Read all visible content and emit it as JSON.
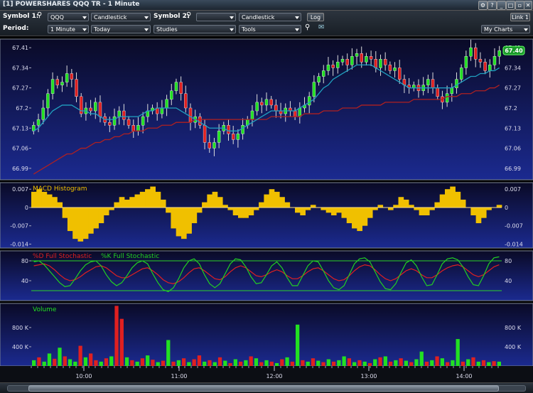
{
  "window": {
    "title": "[1] POWERSHARES QQQ TR - 1 Minute",
    "link_label": "Link 1"
  },
  "toolbar": {
    "symbol1_label": "Symbol 1:",
    "symbol1_value": "QQQ",
    "chart_type1": "Candlestick",
    "symbol2_label": "Symbol 2:",
    "symbol2_value": "",
    "chart_type2": "Candlestick",
    "log_label": "Log",
    "period_label": "Period:",
    "period_value": "1 Minute",
    "range_value": "Today",
    "studies_label": "Studies",
    "tools_label": "Tools",
    "mycharts_label": "My Charts"
  },
  "colors": {
    "up": "#22e022",
    "down": "#e02020",
    "ma_short": "#20a0c0",
    "ma_long": "#b02020",
    "macd": "#f0c000",
    "panel_top": "#0a0a28",
    "panel_bottom": "#1a2a8a"
  },
  "chart_data": [
    {
      "type": "candlestick",
      "yticks": [
        67.41,
        67.34,
        67.27,
        67.2,
        67.13,
        67.06,
        66.99
      ],
      "ylim": [
        66.95,
        67.44
      ],
      "last_price": "67.40",
      "close": [
        67.14,
        67.16,
        67.2,
        67.25,
        67.3,
        67.28,
        67.29,
        67.32,
        67.3,
        67.24,
        67.18,
        67.2,
        67.19,
        67.22,
        67.17,
        67.15,
        67.14,
        67.17,
        67.19,
        67.16,
        67.14,
        67.12,
        67.14,
        67.17,
        67.19,
        67.2,
        67.18,
        67.2,
        67.23,
        67.26,
        67.29,
        67.25,
        67.2,
        67.15,
        67.17,
        67.14,
        67.08,
        67.06,
        67.08,
        67.12,
        67.14,
        67.11,
        67.09,
        67.11,
        67.14,
        67.16,
        67.19,
        67.22,
        67.21,
        67.23,
        67.21,
        67.19,
        67.18,
        67.2,
        67.19,
        67.17,
        67.2,
        67.21,
        67.24,
        67.29,
        67.31,
        67.33,
        67.35,
        67.34,
        67.36,
        67.37,
        67.35,
        67.38,
        67.39,
        67.36,
        67.38,
        67.37,
        67.34,
        67.37,
        67.35,
        67.33,
        67.34,
        67.3,
        67.28,
        67.27,
        67.28,
        67.26,
        67.28,
        67.3,
        67.27,
        67.24,
        67.22,
        67.25,
        67.27,
        67.3,
        67.34,
        67.38,
        67.41,
        67.37,
        67.36,
        67.33,
        67.35,
        67.38,
        67.4
      ],
      "ma_short": [
        67.12,
        67.13,
        67.15,
        67.17,
        67.19,
        67.2,
        67.21,
        67.21,
        67.21,
        67.2,
        67.19,
        67.19,
        67.18,
        67.18,
        67.17,
        67.16,
        67.16,
        67.16,
        67.17,
        67.17,
        67.17,
        67.17,
        67.17,
        67.18,
        67.19,
        67.19,
        67.2,
        67.2,
        67.2,
        67.2,
        67.2,
        67.19,
        67.18,
        67.17,
        67.16,
        67.15,
        67.14,
        67.13,
        67.13,
        67.13,
        67.13,
        67.12,
        67.12,
        67.12,
        67.13,
        67.14,
        67.15,
        67.16,
        67.17,
        67.18,
        67.19,
        67.19,
        67.19,
        67.19,
        67.19,
        67.19,
        67.2,
        67.21,
        67.22,
        67.23,
        67.25,
        67.27,
        67.28,
        67.3,
        67.31,
        67.32,
        67.33,
        67.34,
        67.35,
        67.35,
        67.35,
        67.35,
        67.34,
        67.33,
        67.32,
        67.31,
        67.3,
        67.29,
        67.28,
        67.27,
        67.27,
        67.27,
        67.27,
        67.27,
        67.27,
        67.27,
        67.27,
        67.27,
        67.27,
        67.28,
        67.29,
        67.3,
        67.31,
        67.31,
        67.32,
        67.32,
        67.33,
        67.33,
        67.34
      ],
      "ma_long": [
        66.97,
        66.98,
        66.99,
        67.0,
        67.01,
        67.02,
        67.03,
        67.04,
        67.04,
        67.05,
        67.06,
        67.06,
        67.07,
        67.08,
        67.08,
        67.09,
        67.09,
        67.1,
        67.1,
        67.11,
        67.11,
        67.12,
        67.12,
        67.12,
        67.13,
        67.13,
        67.13,
        67.14,
        67.14,
        67.14,
        67.15,
        67.15,
        67.15,
        67.15,
        67.16,
        67.16,
        67.16,
        67.16,
        67.16,
        67.16,
        67.16,
        67.16,
        67.16,
        67.16,
        67.16,
        67.16,
        67.16,
        67.16,
        67.16,
        67.16,
        67.17,
        67.17,
        67.17,
        67.17,
        67.17,
        67.17,
        67.17,
        67.18,
        67.18,
        67.18,
        67.18,
        67.19,
        67.19,
        67.19,
        67.19,
        67.2,
        67.2,
        67.2,
        67.2,
        67.21,
        67.21,
        67.21,
        67.21,
        67.21,
        67.22,
        67.22,
        67.22,
        67.22,
        67.22,
        67.22,
        67.23,
        67.23,
        67.23,
        67.23,
        67.23,
        67.23,
        67.23,
        67.24,
        67.24,
        67.24,
        67.25,
        67.25,
        67.25,
        67.26,
        67.26,
        67.26,
        67.27,
        67.27,
        67.28
      ]
    },
    {
      "type": "histogram",
      "title": "MACD Histogram",
      "yticks": [
        0.007,
        0,
        -0.007,
        -0.014
      ],
      "ytick_labels": [
        "0.007",
        "0",
        "-0.007",
        "-0.014"
      ],
      "ylim": [
        -0.0155,
        0.0095
      ],
      "values": [
        0.006,
        0.007,
        0.006,
        0.005,
        0.004,
        0.002,
        -0.004,
        -0.009,
        -0.012,
        -0.013,
        -0.012,
        -0.01,
        -0.008,
        -0.006,
        -0.003,
        -0.001,
        0.002,
        0.004,
        0.003,
        0.004,
        0.005,
        0.006,
        0.007,
        0.008,
        0.006,
        0.003,
        -0.002,
        -0.008,
        -0.011,
        -0.012,
        -0.01,
        -0.006,
        -0.002,
        0.002,
        0.005,
        0.006,
        0.004,
        0.001,
        -0.001,
        -0.003,
        -0.004,
        -0.004,
        -0.003,
        -0.001,
        0.002,
        0.005,
        0.007,
        0.006,
        0.004,
        0.002,
        0.0,
        -0.002,
        -0.003,
        -0.001,
        0.001,
        0.0,
        -0.001,
        -0.002,
        -0.003,
        -0.002,
        -0.004,
        -0.006,
        -0.008,
        -0.009,
        -0.007,
        -0.004,
        -0.001,
        0.001,
        0.0,
        -0.001,
        0.001,
        0.004,
        0.003,
        0.001,
        -0.001,
        -0.003,
        -0.003,
        -0.001,
        0.002,
        0.005,
        0.007,
        0.008,
        0.006,
        0.003,
        0.0,
        -0.003,
        -0.006,
        -0.004,
        -0.001,
        0.0,
        0.001
      ],
      "color": "#f0c000"
    },
    {
      "type": "line",
      "legend": [
        "%D Full Stochastic",
        "%K Full Stochastic"
      ],
      "yticks": [
        80,
        40
      ],
      "ylim": [
        0,
        100
      ],
      "reference_lines": [
        80,
        20
      ],
      "series": [
        {
          "name": "%D Full Stochastic",
          "color": "#e02020",
          "values": [
            70,
            72,
            74,
            70,
            62,
            52,
            44,
            40,
            42,
            48,
            56,
            62,
            68,
            70,
            66,
            58,
            50,
            46,
            46,
            52,
            58,
            64,
            66,
            60,
            52,
            42,
            36,
            34,
            38,
            46,
            56,
            64,
            66,
            60,
            52,
            44,
            42,
            48,
            58,
            66,
            70,
            66,
            58,
            50,
            48,
            52,
            58,
            62,
            58,
            50,
            44,
            44,
            50,
            58,
            64,
            66,
            60,
            52,
            44,
            40,
            42,
            50,
            60,
            68,
            72,
            70,
            62,
            52,
            44,
            40,
            44,
            52,
            60,
            64,
            60,
            52,
            46,
            46,
            52,
            60,
            66,
            70,
            72,
            68,
            60,
            52,
            48,
            52,
            60,
            68,
            72
          ]
        },
        {
          "name": "%K Full Stochastic",
          "color": "#22d022",
          "values": [
            78,
            80,
            72,
            60,
            48,
            36,
            28,
            30,
            44,
            60,
            72,
            78,
            80,
            70,
            52,
            38,
            30,
            36,
            50,
            66,
            76,
            80,
            74,
            54,
            36,
            22,
            18,
            26,
            44,
            66,
            80,
            84,
            74,
            52,
            34,
            26,
            34,
            54,
            74,
            84,
            82,
            68,
            48,
            34,
            36,
            52,
            70,
            78,
            66,
            46,
            30,
            30,
            50,
            70,
            80,
            78,
            60,
            40,
            26,
            22,
            30,
            52,
            74,
            84,
            86,
            78,
            58,
            38,
            24,
            22,
            34,
            56,
            76,
            82,
            70,
            48,
            30,
            32,
            52,
            74,
            84,
            86,
            82,
            68,
            48,
            32,
            30,
            50,
            74,
            86,
            88
          ]
        }
      ]
    },
    {
      "type": "bar",
      "title": "Volume",
      "yticks": [
        800,
        400
      ],
      "ytick_labels": [
        "800 K",
        "400 K"
      ],
      "ylim": [
        0,
        1300
      ],
      "values": [
        120,
        180,
        90,
        260,
        150,
        380,
        200,
        140,
        90,
        420,
        180,
        260,
        120,
        90,
        160,
        200,
        1250,
        980,
        180,
        120,
        90,
        160,
        220,
        130,
        80,
        110,
        540,
        90,
        120,
        160,
        80,
        140,
        220,
        90,
        120,
        80,
        180,
        110,
        60,
        140,
        90,
        120,
        200,
        160,
        80,
        120,
        90,
        60,
        140,
        180,
        90,
        860,
        120,
        90,
        160,
        110,
        80,
        140,
        90,
        120,
        200,
        160,
        80,
        120,
        90,
        60,
        140,
        180,
        200,
        90,
        120,
        160,
        110,
        80,
        140,
        300,
        90,
        120,
        200,
        160,
        80,
        120,
        560,
        90,
        140,
        180,
        90,
        120,
        80,
        100,
        90
      ],
      "up": [
        true,
        false,
        true,
        true,
        false,
        true,
        false,
        true,
        true,
        false,
        true,
        false,
        false,
        true,
        false,
        true,
        false,
        false,
        true,
        false,
        true,
        false,
        true,
        false,
        true,
        false,
        true,
        false,
        true,
        false,
        true,
        false,
        false,
        true,
        false,
        true,
        false,
        true,
        false,
        true,
        false,
        true,
        false,
        true,
        false,
        true,
        false,
        true,
        false,
        true,
        false,
        true,
        false,
        true,
        false,
        true,
        false,
        true,
        false,
        true,
        true,
        false,
        true,
        false,
        true,
        false,
        true,
        false,
        true,
        false,
        true,
        false,
        true,
        false,
        true,
        true,
        false,
        true,
        false,
        true,
        false,
        true,
        true,
        false,
        true,
        false,
        true,
        false,
        true,
        false,
        true
      ]
    }
  ],
  "xaxis": {
    "ticks": [
      "10:00",
      "11:00",
      "12:00",
      "13:00",
      "14:00"
    ]
  }
}
